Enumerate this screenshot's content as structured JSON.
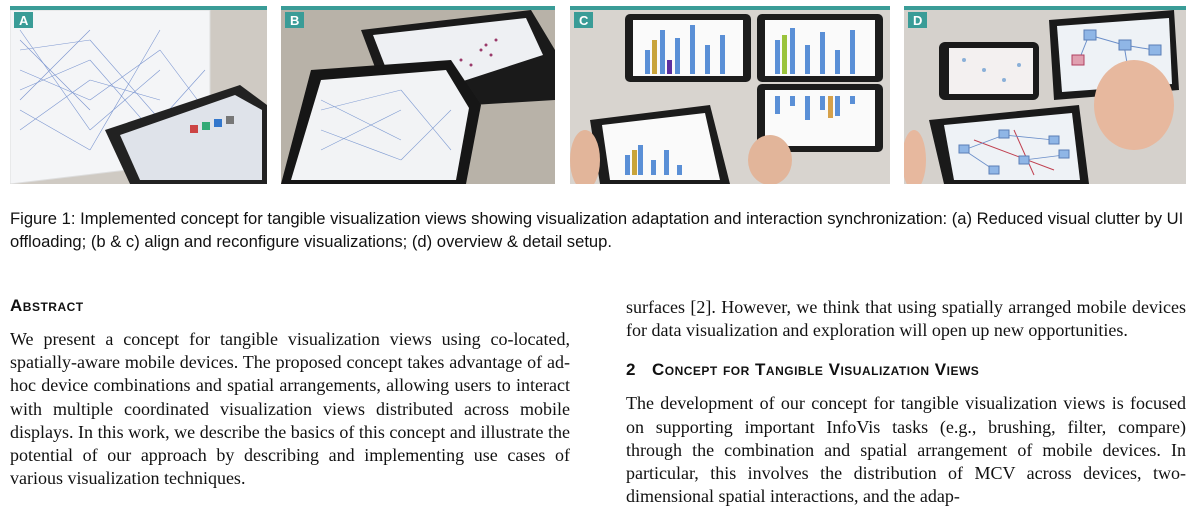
{
  "figure": {
    "panels": [
      {
        "label": "A",
        "icon": "tablet-parallel-coordinates-photo"
      },
      {
        "label": "B",
        "icon": "stacked-tablets-scatter-photo"
      },
      {
        "label": "C",
        "icon": "bar-chart-tablets-photo"
      },
      {
        "label": "D",
        "icon": "node-link-tablets-photo"
      }
    ],
    "caption": "Figure 1: Implemented concept for tangible visualization views showing visualization adaptation and interaction synchronization: (a) Reduced visual clutter by UI offloading; (b & c) align and reconfigure visualizations; (d) overview & detail setup.",
    "accent_color": "#3a9c97"
  },
  "abstract": {
    "title": "Abstract",
    "body": "We present a concept for tangible visualization views using co-located, spatially-aware mobile devices. The proposed concept takes advantage of ad-hoc device combinations and spatial arrangements, allowing users to interact with multiple coordinated visualization views distributed across mobile displays. In this work, we describe the basics of this concept and illustrate the potential of our approach by describing and implementing use cases of various visualization techniques."
  },
  "right_column": {
    "continuation": "surfaces [2]. However, we think that using spatially arranged mobile devices for data visualization and exploration will open up new opportunities.",
    "section_number": "2",
    "section_title": "Concept for Tangible Visualization Views",
    "section_body": "The development of our concept for tangible visualization views is focused on supporting important InfoVis tasks (e.g., brushing, filter, compare) through the combination and spatial arrangement of mobile devices. In particular, this involves the distribution of MCV across devices, two-dimensional spatial interactions, and the adap-"
  }
}
